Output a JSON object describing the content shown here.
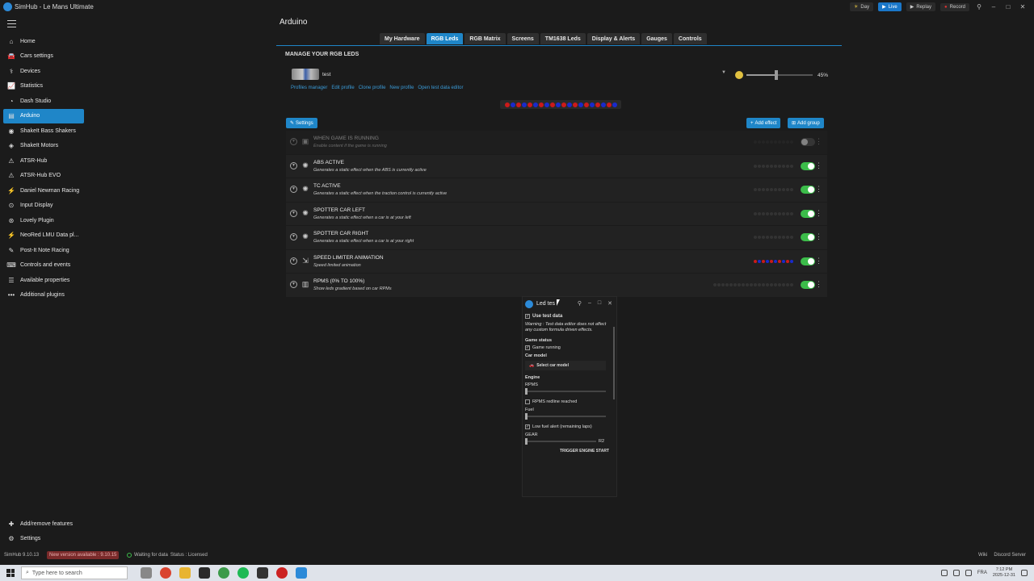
{
  "titlebar": {
    "title": "SimHub - Le Mans Ultimate",
    "day_label": "Day",
    "live_label": "Live",
    "replay_label": "Replay",
    "record_label": "Record"
  },
  "sidebar": {
    "items": [
      {
        "label": "Home",
        "icon": "home-icon"
      },
      {
        "label": "Cars settings",
        "icon": "car-icon"
      },
      {
        "label": "Devices",
        "icon": "usb-icon"
      },
      {
        "label": "Statistics",
        "icon": "chart-icon"
      },
      {
        "label": "Dash Studio",
        "icon": "gauge-icon"
      },
      {
        "label": "Arduino",
        "icon": "arduino-icon",
        "active": true
      },
      {
        "label": "ShakeIt Bass Shakers",
        "icon": "speaker-icon"
      },
      {
        "label": "ShakeIt Motors",
        "icon": "motor-icon"
      },
      {
        "label": "ATSR-Hub",
        "icon": "warning-icon"
      },
      {
        "label": "ATSR-Hub EVO",
        "icon": "warning-icon"
      },
      {
        "label": "Daniel Newman Racing",
        "icon": "plug-icon"
      },
      {
        "label": "Input Display",
        "icon": "input-icon"
      },
      {
        "label": "Lovely Plugin",
        "icon": "lovely-icon"
      },
      {
        "label": "NeoRed LMU Data pl...",
        "icon": "plug-icon"
      },
      {
        "label": "Post-It Note Racing",
        "icon": "note-icon"
      },
      {
        "label": "Controls and events",
        "icon": "keyboard-icon"
      },
      {
        "label": "Available properties",
        "icon": "list-icon"
      },
      {
        "label": "Additional plugins",
        "icon": "more-icon"
      }
    ],
    "bottom": [
      {
        "label": "Add/remove features",
        "icon": "puzzle-icon"
      },
      {
        "label": "Settings",
        "icon": "gear-icon"
      }
    ]
  },
  "statusbar": {
    "version": "SimHub 9.10.13",
    "update": "New version available : 9.10.15",
    "waiting": "Waiting for data",
    "status": "Status : Licensed",
    "wiki": "Wiki",
    "discord": "Discord Server"
  },
  "taskbar": {
    "search_placeholder": "Type here to search",
    "time": "7:12 PM",
    "date": "2025-12-31",
    "lang": "FRA"
  },
  "main": {
    "page_title": "Arduino",
    "tabs": [
      "My Hardware",
      "RGB Leds",
      "RGB Matrix",
      "Screens",
      "TM1638 Leds",
      "Display & Alerts",
      "Gauges",
      "Controls"
    ],
    "active_tab": 1,
    "section_title": "MANAGE YOUR RGB LEDS",
    "profile_name": "test",
    "profile_links": [
      "Profiles manager",
      "Edit profile",
      "Clone profile",
      "New profile",
      "Open test data editor"
    ],
    "brightness": "45%",
    "brightness_value": 0.45,
    "led_colors": [
      "#cc1a1a",
      "#1a2acc",
      "#cc1a1a",
      "#1a2acc",
      "#cc1a1a",
      "#1a2acc",
      "#cc1a1a",
      "#1a2acc",
      "#cc1a1a",
      "#1a2acc",
      "#cc1a1a",
      "#1a2acc",
      "#cc1a1a",
      "#1a2acc",
      "#cc1a1a",
      "#1a2acc",
      "#cc1a1a",
      "#1a2acc",
      "#cc1a1a",
      "#1a2acc"
    ],
    "settings_label": "Settings",
    "add_effect_label": "Add effect",
    "add_group_label": "Add group"
  },
  "effects": [
    {
      "title": "WHEN GAME IS RUNNING",
      "desc": "Enable content if the game is running",
      "enabled": false,
      "dim": true,
      "icon": "game-icon"
    },
    {
      "title": "ABS ACTIVE",
      "desc": "Generates a static effect when the ABS is currently active",
      "enabled": true,
      "icon": "light-icon"
    },
    {
      "title": "TC ACTIVE",
      "desc": "Generates a static effect when the traction control is currently active",
      "enabled": true,
      "icon": "light-icon"
    },
    {
      "title": "SPOTTER CAR LEFT",
      "desc": "Generates a static effect when a car is at your left",
      "enabled": true,
      "icon": "light-icon"
    },
    {
      "title": "SPOTTER CAR RIGHT",
      "desc": "Generates a static effect when a car is at your right",
      "enabled": true,
      "icon": "light-icon"
    },
    {
      "title": "SPEED LIMITER ANIMATION",
      "desc": "Speed limited animation",
      "enabled": true,
      "icon": "animation-icon",
      "colored": true
    },
    {
      "title": "RPMS (0% TO 100%)",
      "desc": "Show leds gradient based on car RPMs",
      "enabled": true,
      "icon": "gradient-icon"
    }
  ],
  "popup": {
    "title": "Led tes",
    "use_test_data": "Use test data",
    "warning": "Warning : Test data editor does not affect any custom formula driven effects.",
    "game_status": "Game status",
    "game_running": "Game running",
    "car_model": "Car model",
    "select_car_model": "Select car model",
    "engine": "Engine",
    "rpms": "RPMS",
    "rpms_redline": "RPMS redline reached",
    "fuel": "Fuel",
    "low_fuel": "Low fuel alert (remaining laps)",
    "gear": "GEAR",
    "gear_value": "R2",
    "trigger": "TRIGGER ENGINE START"
  }
}
